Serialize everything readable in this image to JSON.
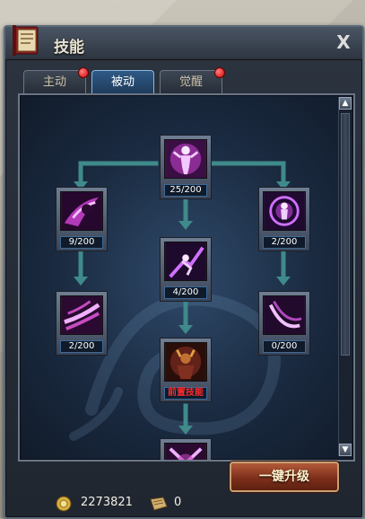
{
  "window": {
    "title": "技能",
    "close_label": "X"
  },
  "tabs": [
    {
      "label": "主动",
      "badge": true
    },
    {
      "label": "被动",
      "badge": false,
      "active": true
    },
    {
      "label": "觉醒",
      "badge": true
    }
  ],
  "skills": [
    {
      "id": "root",
      "label": "25/200",
      "icon": "spirit-figure-icon",
      "color": "#c040c8"
    },
    {
      "id": "left1",
      "label": "9/200",
      "icon": "shadow-dash-icon",
      "color": "#b23ab8"
    },
    {
      "id": "mid1",
      "label": "4/200",
      "icon": "leap-strike-icon",
      "color": "#9b2fb0"
    },
    {
      "id": "right1",
      "label": "2/200",
      "icon": "aura-burst-icon",
      "color": "#a83cc4"
    },
    {
      "id": "left2",
      "label": "2/200",
      "icon": "slash-wave-icon",
      "color": "#c64bc0"
    },
    {
      "id": "mid2",
      "label": "前置技能",
      "icon": "demon-warrior-icon",
      "color": "#7a2a20",
      "locked": true
    },
    {
      "id": "right2",
      "label": "0/200",
      "icon": "crescent-blade-icon",
      "color": "#b048c0"
    },
    {
      "id": "mid3",
      "label": "",
      "icon": "cross-slash-icon",
      "color": "#c040b8"
    }
  ],
  "footer": {
    "coin_icon": "gold-coin-icon",
    "coin_value": "2273821",
    "scroll_icon": "skill-book-icon",
    "scroll_value": "0",
    "upgrade_label": "一键升级"
  },
  "scroll": {
    "up_icon": "scroll-up-icon",
    "down_icon": "scroll-down-icon"
  },
  "colors": {
    "connector": "#3f8a8a",
    "accent": "#2f5a86"
  }
}
